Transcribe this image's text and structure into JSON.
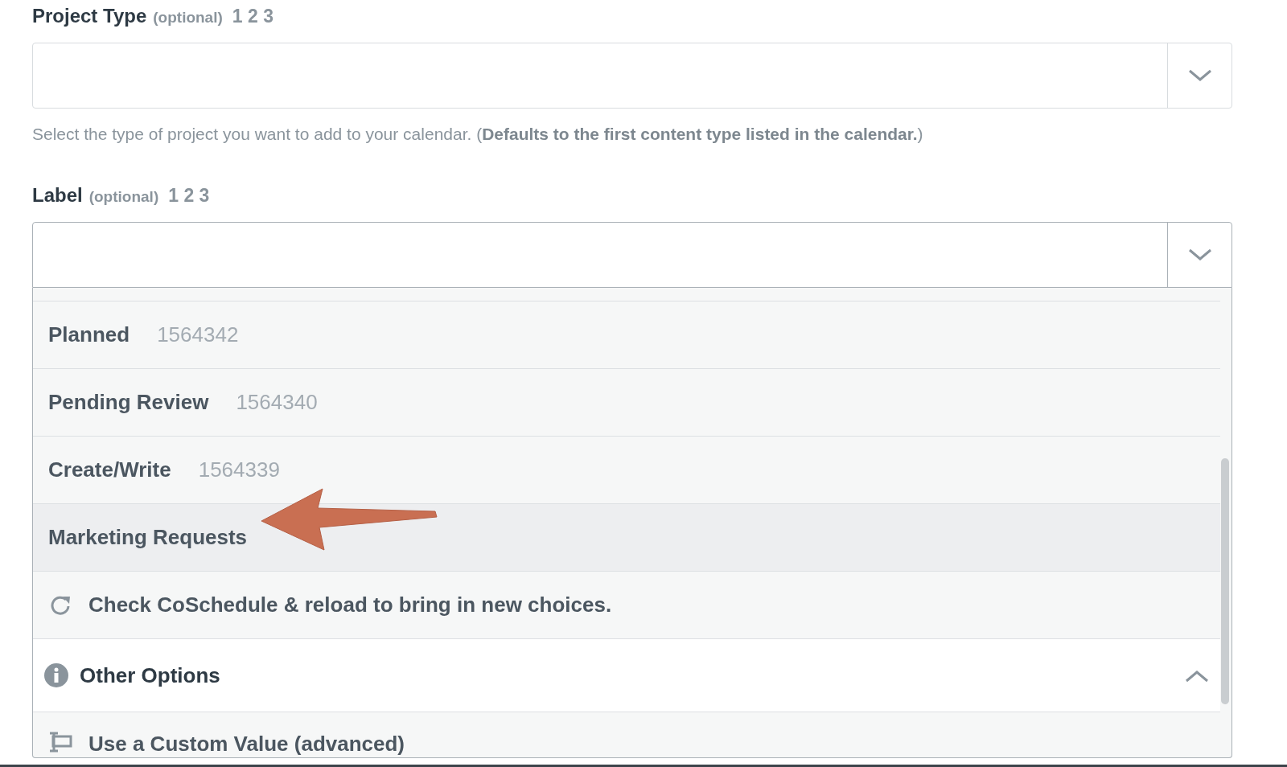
{
  "fields": [
    {
      "label": "Project Type",
      "optional": "(optional)",
      "numbers": "1 2 3",
      "expanded": false,
      "help": "Select the type of project you want to add to your calendar. (**Defaults to the first content type listed in the calendar.**)"
    },
    {
      "label": "Label",
      "optional": "(optional)",
      "numbers": "1 2 3",
      "expanded": true,
      "options": [
        {
          "kind": "option",
          "name": "Planned",
          "id": "1564342",
          "selected": false
        },
        {
          "kind": "option",
          "name": "Pending Review",
          "id": "1564340",
          "selected": false
        },
        {
          "kind": "option",
          "name": "Create/Write",
          "id": "1564339",
          "selected": false
        },
        {
          "kind": "option",
          "name": "Marketing Requests",
          "selected": true
        },
        {
          "kind": "reload",
          "name": "Check CoSchedule & reload to bring in new choices."
        },
        {
          "kind": "section",
          "name": "Other Options",
          "expanded": true
        },
        {
          "kind": "custom",
          "name": "Use a Custom Value (advanced)"
        }
      ]
    }
  ]
}
